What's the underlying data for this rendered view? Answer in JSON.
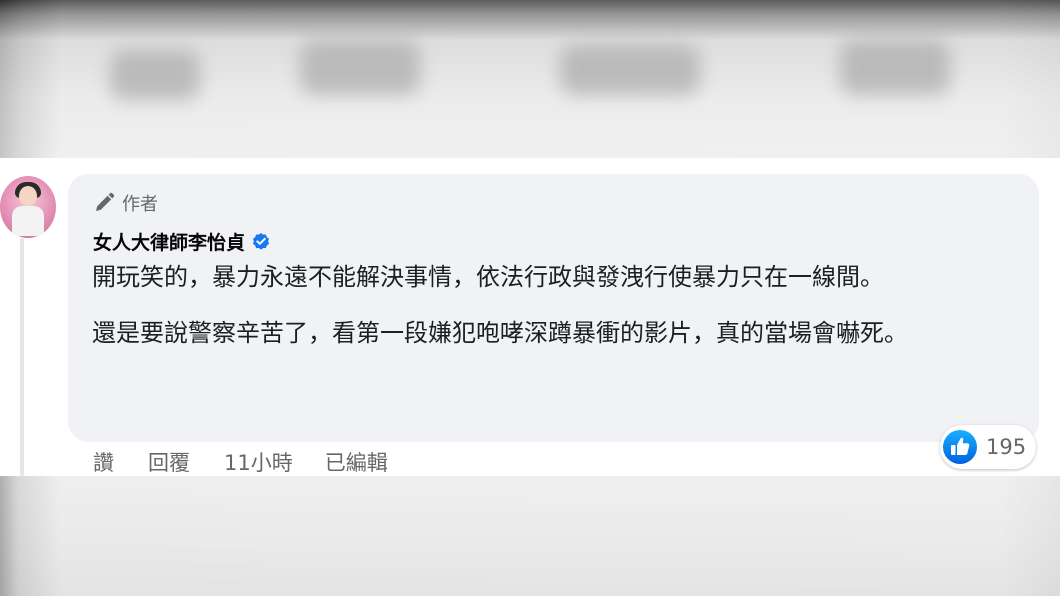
{
  "comment": {
    "author_badge": "作者",
    "author_name": "女人大律師李怡貞",
    "verified": true,
    "paragraphs": [
      "開玩笑的，暴力永遠不能解決事情，依法行政與發洩行使暴力只在一線間。",
      "還是要說警察辛苦了，看第一段嫌犯咆哮深蹲暴衝的影片，真的當場會嚇死。"
    ],
    "actions": {
      "like": "讚",
      "reply": "回覆",
      "timestamp": "11小時",
      "edited": "已編輯"
    },
    "reactions": {
      "icon": "like-icon",
      "count": "195"
    }
  },
  "icons": {
    "author_badge": "pencil-icon",
    "verified": "verified-badge-icon"
  },
  "colors": {
    "bubble": "#f0f2f5",
    "text": "#1c1e21",
    "secondary_text": "#65676b",
    "accent_blue": "#1877f2"
  }
}
